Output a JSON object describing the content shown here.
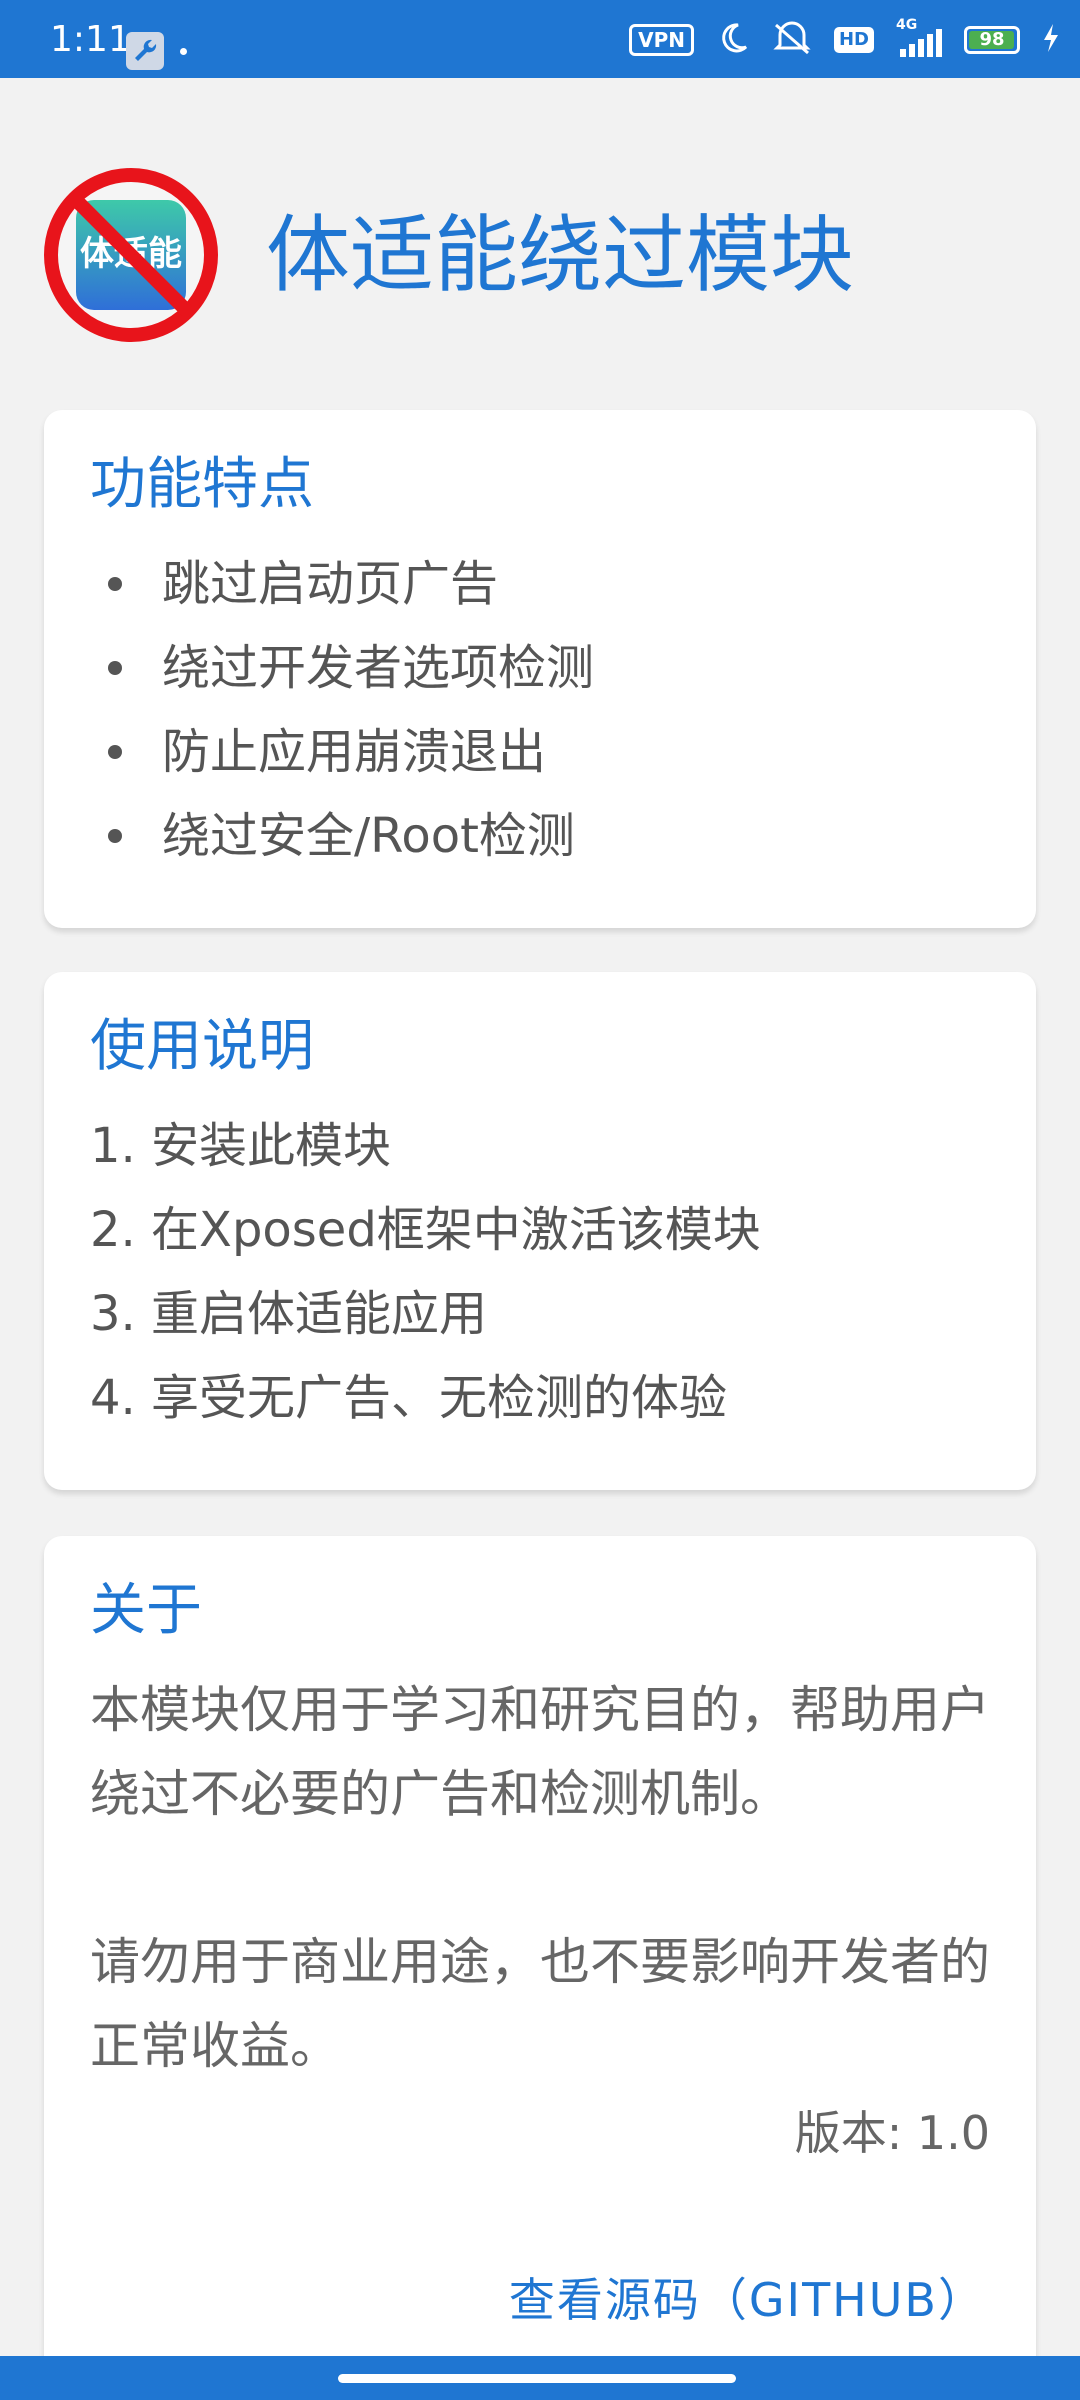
{
  "status_bar": {
    "time": "1:11",
    "vpn": "VPN",
    "hd": "HD",
    "network": "4G",
    "battery_level": "98",
    "battery_fraction": 0.98,
    "icons": [
      "wrench-icon",
      "moon-icon",
      "mute-icon",
      "signal-icon",
      "charging-icon"
    ],
    "bg_color": "#1f76d2"
  },
  "header": {
    "logo_text": "体适能",
    "title": "体适能绕过模块"
  },
  "features": {
    "title": "功能特点",
    "items": [
      "跳过启动页广告",
      "绕过开发者选项检测",
      "防止应用崩溃退出",
      "绕过安全/Root检测"
    ]
  },
  "instructions": {
    "title": "使用说明",
    "steps": [
      "1. 安装此模块",
      "2. 在Xposed框架中激活该模块",
      "3. 重启体适能应用",
      "4. 享受无广告、无检测的体验"
    ]
  },
  "about": {
    "title": "关于",
    "paragraph1": "本模块仅用于学习和研究目的，帮助用户绕过不必要的广告和检测机制。",
    "paragraph2": "请勿用于商业用途，也不要影响开发者的正常收益。",
    "version": "版本: 1.0",
    "source_button": "查看源码（GITHUB）"
  },
  "theme": {
    "accent": "#1f76d2",
    "background": "#f2f2f2",
    "card": "#ffffff",
    "text": "#555555"
  }
}
